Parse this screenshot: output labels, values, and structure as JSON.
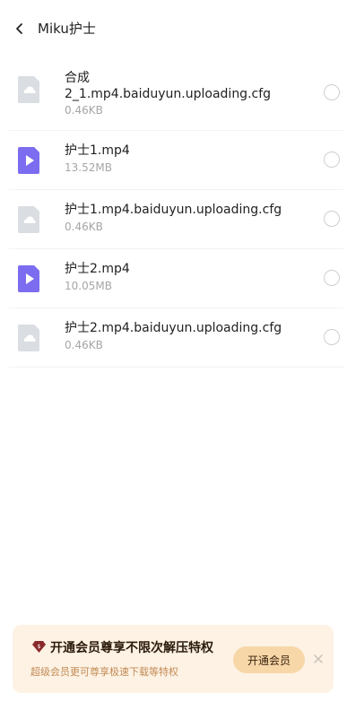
{
  "header": {
    "title": "Miku护士",
    "back_icon": "chevron-left-icon"
  },
  "files": [
    {
      "name": "合成\n2_1.mp4.baiduyun.uploading.cfg",
      "size": "0.46KB",
      "type": "cloud-file-icon",
      "color": "#c9cdd3"
    },
    {
      "name": "护士1.mp4",
      "size": "13.52MB",
      "type": "video-file-icon",
      "color": "#7b6cf0"
    },
    {
      "name": "护士1.mp4.baiduyun.uploading.cfg",
      "size": "0.46KB",
      "type": "cloud-file-icon",
      "color": "#c9cdd3"
    },
    {
      "name": "护士2.mp4",
      "size": "10.05MB",
      "type": "video-file-icon",
      "color": "#7b6cf0"
    },
    {
      "name": "护士2.mp4.baiduyun.uploading.cfg",
      "size": "0.46KB",
      "type": "cloud-file-icon",
      "color": "#c9cdd3"
    }
  ],
  "promo": {
    "title": "开通会员尊享不限次解压特权",
    "subtitle": "超级会员更可尊享极速下载等特权",
    "button_label": "开通会员",
    "badge_icon": "diamond-badge-icon",
    "close_icon": "close-icon",
    "background": "#fdf2e4",
    "button_color": "#f7d7a8"
  }
}
